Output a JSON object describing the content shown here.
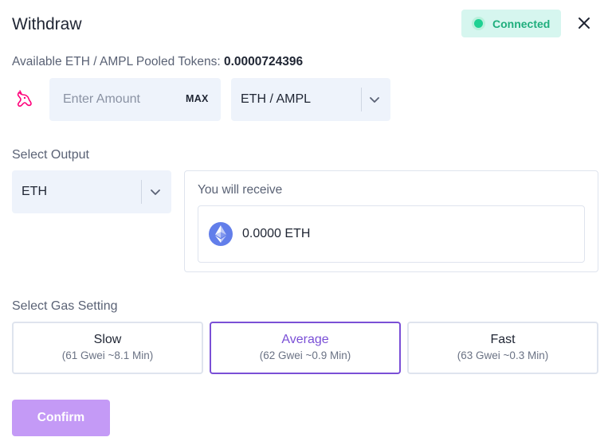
{
  "header": {
    "title": "Withdraw",
    "status": "Connected",
    "status_color": "#1fd193"
  },
  "available": {
    "label": "Available ETH / AMPL Pooled Tokens:",
    "value": "0.0000724396"
  },
  "amount": {
    "placeholder": "Enter Amount",
    "value": "",
    "max_label": "MAX",
    "protocol_icon": "uniswap-unicorn-icon"
  },
  "pool_select": {
    "selected": "ETH / AMPL"
  },
  "output": {
    "label": "Select Output",
    "selected": "ETH",
    "receive_label": "You will receive",
    "receive_amount": "0.0000 ETH"
  },
  "gas": {
    "label": "Select Gas Setting",
    "options": [
      {
        "name": "Slow",
        "detail": "(61 Gwei ~8.1 Min)",
        "active": false
      },
      {
        "name": "Average",
        "detail": "(62 Gwei ~0.9 Min)",
        "active": true
      },
      {
        "name": "Fast",
        "detail": "(63 Gwei ~0.3 Min)",
        "active": false
      }
    ]
  },
  "confirm_label": "Confirm",
  "colors": {
    "accent": "#7a4fd6",
    "confirm_bg": "#c49af6",
    "input_bg": "#eef3fb"
  }
}
